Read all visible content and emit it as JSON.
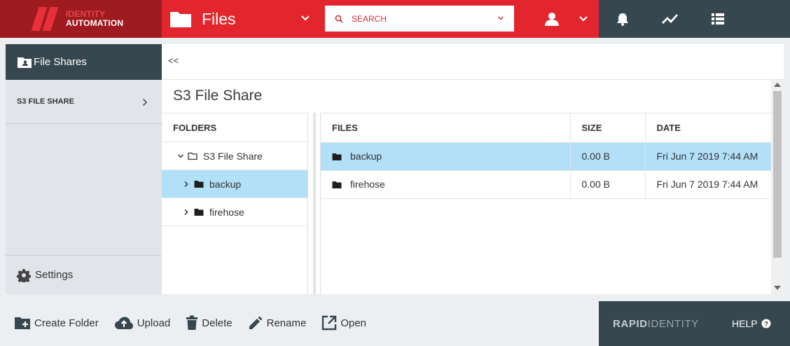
{
  "brand": {
    "logo_line1": "IDENTITY",
    "logo_line2": "AUTOMATION"
  },
  "app": {
    "title": "Files"
  },
  "search": {
    "placeholder": "SEARCH"
  },
  "sidebar": {
    "header": "File Shares",
    "items": [
      {
        "label": "S3 FILE SHARE"
      }
    ],
    "settings": "Settings"
  },
  "main": {
    "collapse_label": "<<",
    "title": "S3 File Share",
    "folders": {
      "header": "FOLDERS",
      "root": "S3 File Share",
      "children": [
        {
          "label": "backup"
        },
        {
          "label": "firehose"
        }
      ]
    },
    "files": {
      "columns": [
        "FILES",
        "SIZE",
        "DATE"
      ],
      "rows": [
        {
          "name": "backup",
          "size": "0.00 B",
          "date": "Fri Jun 7 2019 7:44 AM"
        },
        {
          "name": "firehose",
          "size": "0.00 B",
          "date": "Fri Jun 7 2019 7:44 AM"
        }
      ]
    }
  },
  "toolbar": {
    "create_folder": "Create Folder",
    "upload": "Upload",
    "delete": "Delete",
    "rename": "Rename",
    "open": "Open"
  },
  "footer": {
    "brand_part1": "RAPID",
    "brand_part2": "IDENTITY",
    "help": "HELP"
  },
  "colors": {
    "brand_dark_red": "#9e1b1f",
    "brand_red": "#e3262d",
    "slate": "#37474f",
    "selection": "#b3e0f9"
  }
}
